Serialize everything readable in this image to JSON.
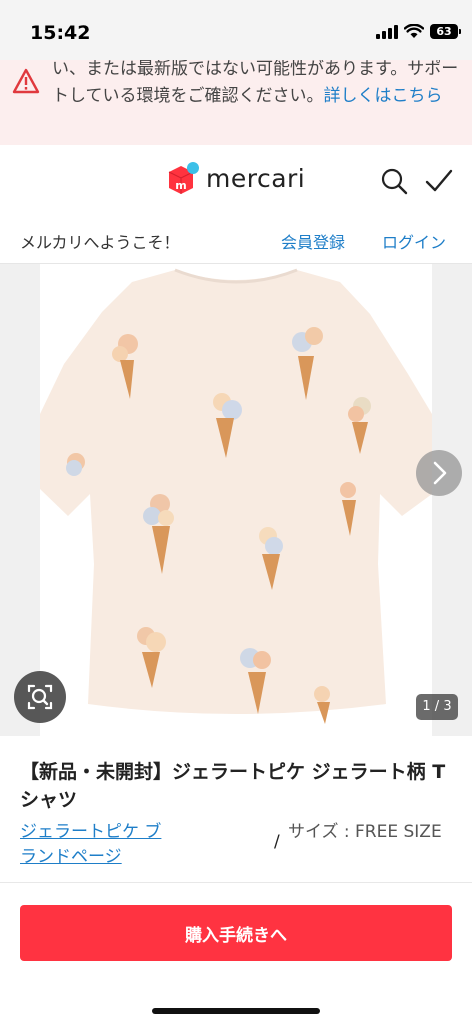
{
  "status_bar": {
    "time": "15:42",
    "battery": "63"
  },
  "warning": {
    "text": "い、または最新版ではない可能性があります。サポートしている環境をご確認ください。",
    "link": "詳しくはこちら"
  },
  "header": {
    "logo_text": "mercari",
    "brand_color": "#ff333f"
  },
  "welcome_bar": {
    "welcome_text": "メルカリへようこそ！",
    "signup_label": "会員登録",
    "login_label": "ログイン"
  },
  "gallery": {
    "page_indicator": "1 / 3"
  },
  "product": {
    "title": "【新品・未開封】ジェラートピケ ジェラート柄 Tシャツ",
    "brand_link": "ジェラートピケ ブランドページ",
    "separator": "/",
    "size": "サイズ : FREE SIZE"
  },
  "actions": {
    "buy_label": "購入手続きへ",
    "buy_color": "#ff3341"
  }
}
